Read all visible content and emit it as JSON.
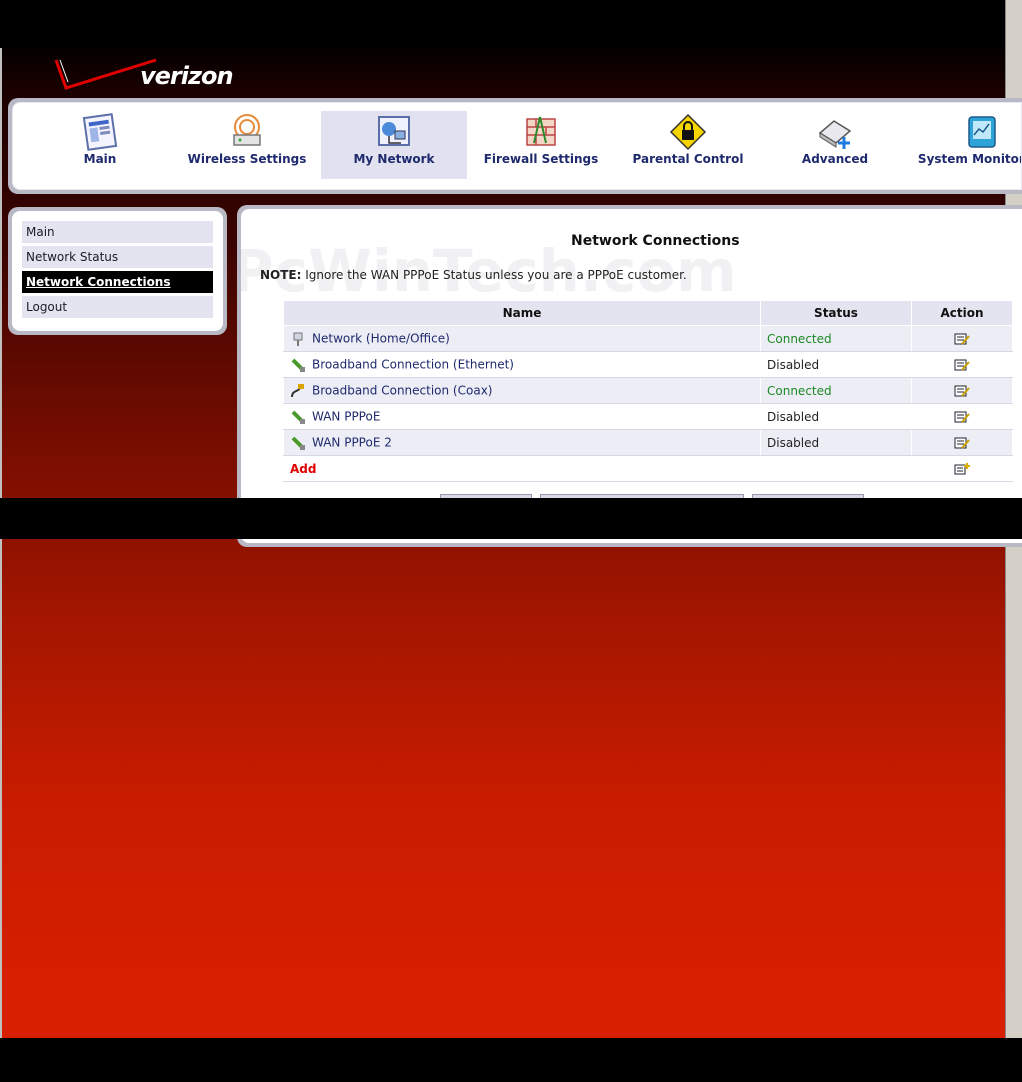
{
  "brand": {
    "logo_text": "verizon"
  },
  "top_nav": [
    {
      "label": "Main",
      "icon": "main-icon"
    },
    {
      "label": "Wireless Settings",
      "icon": "wireless-icon"
    },
    {
      "label": "My Network",
      "icon": "network-icon",
      "active": true
    },
    {
      "label": "Firewall Settings",
      "icon": "firewall-icon"
    },
    {
      "label": "Parental Control",
      "icon": "parental-lock-icon"
    },
    {
      "label": "Advanced",
      "icon": "advanced-icon"
    },
    {
      "label": "System Monitoring",
      "icon": "monitor-icon"
    }
  ],
  "sidebar": {
    "items": [
      {
        "label": "Main"
      },
      {
        "label": "Network Status"
      },
      {
        "label": "Network Connections",
        "active": true
      },
      {
        "label": "Logout"
      }
    ]
  },
  "main": {
    "title": "Network Connections",
    "note_label": "NOTE:",
    "note_text": " Ignore the WAN PPPoE Status unless you are a PPPoE customer.",
    "watermark": "PcWinTech.com",
    "columns": [
      "Name",
      "Status",
      "Action"
    ],
    "rows": [
      {
        "name": "Network (Home/Office)",
        "status": "Connected"
      },
      {
        "name": "Broadband Connection (Ethernet)",
        "status": "Disabled"
      },
      {
        "name": "Broadband Connection (Coax)",
        "status": "Connected"
      },
      {
        "name": "WAN PPPoE",
        "status": "Disabled"
      },
      {
        "name": "WAN PPPoE 2",
        "status": "Disabled"
      }
    ],
    "add_label": "Add"
  },
  "colors": {
    "connected": "#1b8a24",
    "add": "#e00000",
    "nav_text": "#1f2a6e"
  }
}
